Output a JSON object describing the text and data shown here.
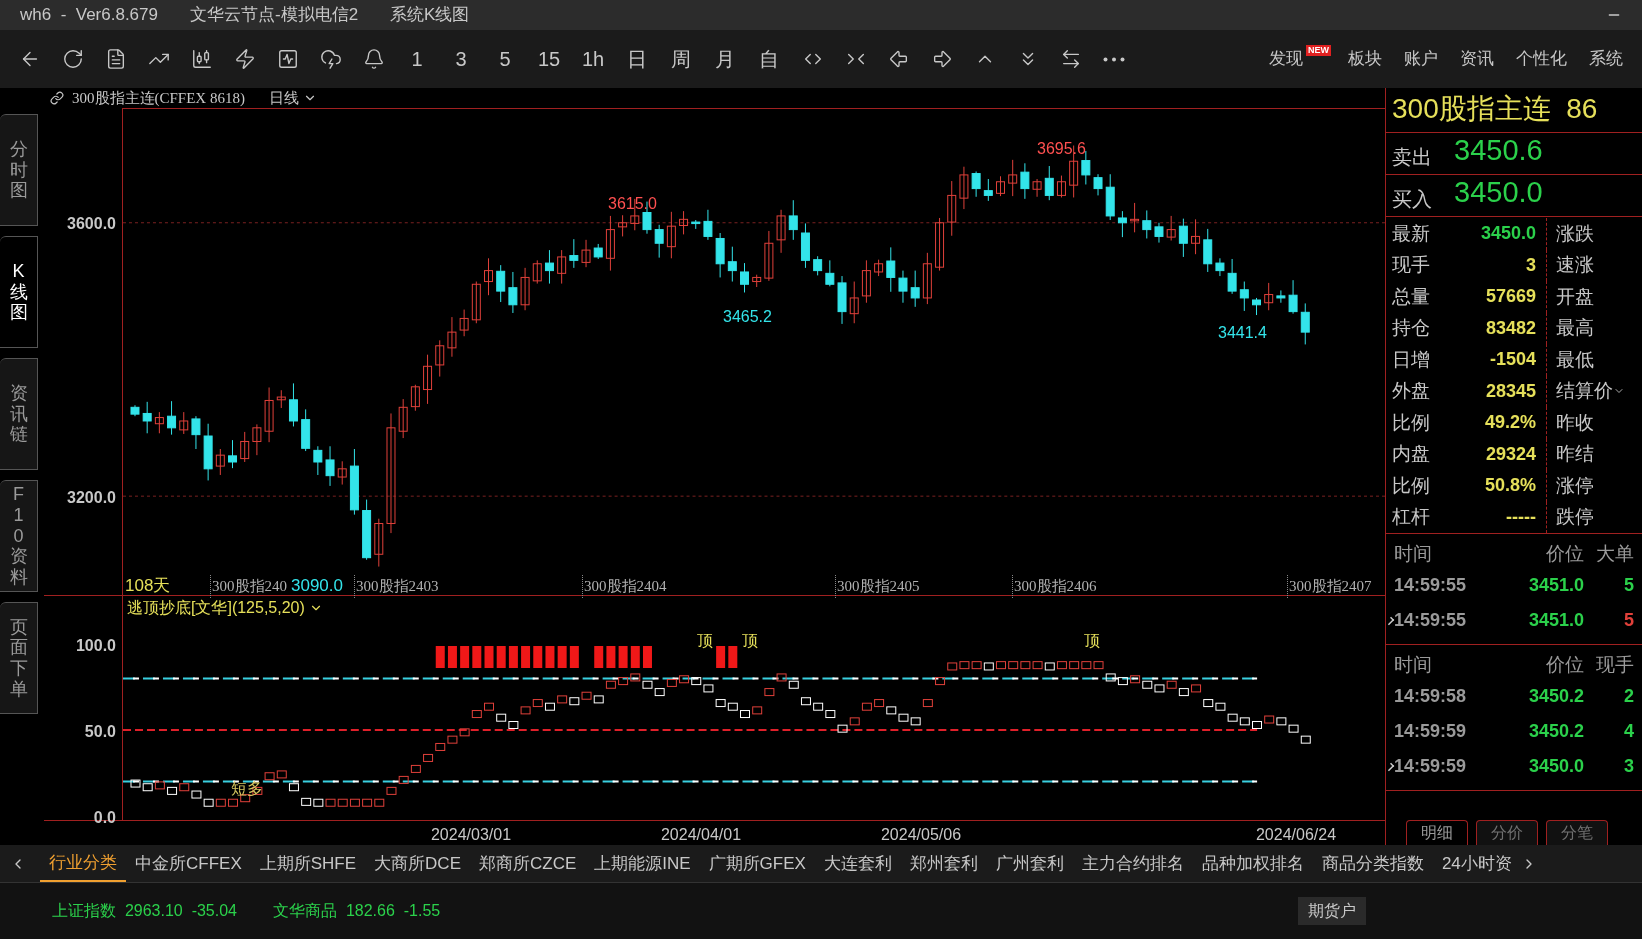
{
  "window": {
    "title_parts": [
      "wh6  -  Ver6.8.679",
      "文华云节点-模拟电信2",
      "系统K线图"
    ]
  },
  "toolbar": {
    "period_buttons": [
      "1",
      "3",
      "5",
      "15",
      "1h",
      "日",
      "周",
      "月",
      "自"
    ],
    "nav": [
      {
        "label": "发现",
        "badge": "NEW"
      },
      {
        "label": "板块"
      },
      {
        "label": "账户"
      },
      {
        "label": "资讯"
      },
      {
        "label": "个性化"
      },
      {
        "label": "系统"
      }
    ]
  },
  "chart_header": {
    "symbol": "300股指主连(CFFEX 8618)",
    "period": "日线"
  },
  "side_tabs": [
    {
      "label": "分时图",
      "selected": false
    },
    {
      "label": "K线图",
      "selected": true
    },
    {
      "label": "资讯链",
      "selected": false
    },
    {
      "label": "F10资料",
      "selected": false
    },
    {
      "label": "页面下单",
      "selected": false
    }
  ],
  "price_chart": {
    "y_labels": [
      {
        "label": "3600.0",
        "kind": "upper"
      },
      {
        "label": "3200.0",
        "kind": "lower"
      }
    ],
    "annotations": [
      {
        "text": "3615.0",
        "kind": "high"
      },
      {
        "text": "3695.6",
        "kind": "high"
      },
      {
        "text": "3465.2",
        "kind": "low"
      },
      {
        "text": "3441.4",
        "kind": "low"
      }
    ],
    "bar_count": "108天",
    "low_label": "3090.0",
    "contracts": [
      "300股指240",
      "300股指2403",
      "300股指2404",
      "300股指2405",
      "300股指2406",
      "300股指2407"
    ]
  },
  "indicator": {
    "title": "逃顶抄底[文华](125,5,20)",
    "y_labels": [
      "100.0",
      "50.0",
      "0.0"
    ],
    "signals": [
      {
        "text": "顶",
        "kind": "top"
      },
      {
        "text": "顶",
        "kind": "top"
      },
      {
        "text": "顶",
        "kind": "top"
      },
      {
        "text": "短多",
        "kind": "long"
      }
    ]
  },
  "dates": [
    "2024/03/01",
    "2024/04/01",
    "2024/05/06",
    "2024/06/24"
  ],
  "quote": {
    "title": "300股指主连  86",
    "sell_label": "卖出",
    "sell": "3450.6",
    "buy_label": "买入",
    "buy": "3450.0",
    "stats": [
      {
        "label": "最新",
        "value": "3450.0",
        "kind": "price",
        "right_label": "涨跌",
        "dropdown": false
      },
      {
        "label": "现手",
        "value": "3",
        "kind": "num",
        "right_label": "速涨",
        "dropdown": false
      },
      {
        "label": "总量",
        "value": "57669",
        "kind": "num",
        "right_label": "开盘",
        "dropdown": false
      },
      {
        "label": "持仓",
        "value": "83482",
        "kind": "num",
        "right_label": "最高",
        "dropdown": false
      },
      {
        "label": "日增",
        "value": "-1504",
        "kind": "num",
        "right_label": "最低",
        "dropdown": false
      },
      {
        "label": "外盘",
        "value": "28345",
        "kind": "num",
        "right_label": "结算价",
        "dropdown": true
      },
      {
        "label": "比例",
        "value": "49.2%",
        "kind": "num",
        "right_label": "昨收",
        "dropdown": false
      },
      {
        "label": "内盘",
        "value": "29324",
        "kind": "num",
        "right_label": "昨结",
        "dropdown": false
      },
      {
        "label": "比例",
        "value": "50.8%",
        "kind": "num",
        "right_label": "涨停",
        "dropdown": false
      },
      {
        "label": "杠杆",
        "value": "-----",
        "kind": "num",
        "right_label": "跌停",
        "dropdown": false
      }
    ]
  },
  "trade_tables": [
    {
      "columns": [
        "时间",
        "价位",
        "大单"
      ],
      "rows": [
        {
          "time": "14:59:55",
          "price": "3451.0",
          "volume": "5",
          "color": "#2bd14b",
          "marked": false
        },
        {
          "time": "14:59:55",
          "price": "3451.0",
          "volume": "5",
          "color": "#e0403a",
          "marked": true
        }
      ]
    },
    {
      "columns": [
        "时间",
        "价位",
        "现手"
      ],
      "rows": [
        {
          "time": "14:59:58",
          "price": "3450.2",
          "volume": "2",
          "color": "#2bd14b",
          "marked": false
        },
        {
          "time": "14:59:59",
          "price": "3450.2",
          "volume": "4",
          "color": "#2bd14b",
          "marked": false
        },
        {
          "time": "14:59:59",
          "price": "3450.0",
          "volume": "3",
          "color": "#2bd14b",
          "marked": true
        }
      ]
    }
  ],
  "panel_tabs": [
    {
      "label": "明细",
      "selected": true
    },
    {
      "label": "分价",
      "selected": false
    },
    {
      "label": "分笔",
      "selected": false
    }
  ],
  "market_tabs": [
    {
      "label": "行业分类",
      "selected": true
    },
    {
      "label": "中金所CFFEX",
      "selected": false
    },
    {
      "label": "上期所SHFE",
      "selected": false
    },
    {
      "label": "大商所DCE",
      "selected": false
    },
    {
      "label": "郑商所CZCE",
      "selected": false
    },
    {
      "label": "上期能源INE",
      "selected": false
    },
    {
      "label": "广期所GFEX",
      "selected": false
    },
    {
      "label": "大连套利",
      "selected": false
    },
    {
      "label": "郑州套利",
      "selected": false
    },
    {
      "label": "广州套利",
      "selected": false
    },
    {
      "label": "主力合约排名",
      "selected": false
    },
    {
      "label": "品种加权排名",
      "selected": false
    },
    {
      "label": "商品分类指数",
      "selected": false
    },
    {
      "label": "24小时资",
      "selected": false
    }
  ],
  "status_bar": {
    "indices": [
      {
        "name": "上证指数",
        "value": "2963.10",
        "change": "-35.04"
      },
      {
        "name": "文华商品",
        "value": "182.66",
        "change": "-1.55"
      }
    ],
    "account_button": "期货户"
  }
}
